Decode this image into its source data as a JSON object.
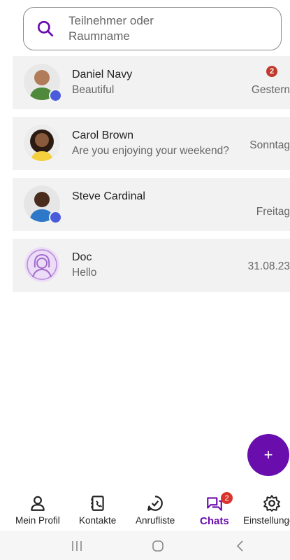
{
  "search": {
    "placeholder": "Teilnehmer oder Raumname"
  },
  "chats": [
    {
      "name": "Daniel Navy",
      "message": "Beautiful",
      "time": "Gestern",
      "unread": "2",
      "online": true,
      "avatar": "person-avatar"
    },
    {
      "name": "Carol Brown",
      "message": "Are you enjoying your weekend?",
      "time": "Sonntag",
      "unread": null,
      "online": false,
      "avatar": "person-avatar"
    },
    {
      "name": "Steve Cardinal",
      "message": "",
      "time": "Freitag",
      "unread": null,
      "online": true,
      "avatar": "person-avatar"
    },
    {
      "name": "Doc",
      "message": "Hello",
      "time": "31.08.23",
      "unread": null,
      "online": false,
      "avatar": "bot-avatar"
    }
  ],
  "fab": {
    "label": "+"
  },
  "nav": {
    "items": [
      {
        "label": "Mein Profil",
        "icon": "person-icon"
      },
      {
        "label": "Kontakte",
        "icon": "contacts-book-icon"
      },
      {
        "label": "Anrufliste",
        "icon": "call-history-icon"
      },
      {
        "label": "Chats",
        "icon": "chat-bubbles-icon",
        "badge": "2",
        "active": true
      },
      {
        "label": "Einstellungen",
        "icon": "gear-icon"
      }
    ]
  },
  "colors": {
    "accent": "#6a0dad",
    "badge": "#d9342b",
    "presence": "#4a5bdc"
  }
}
